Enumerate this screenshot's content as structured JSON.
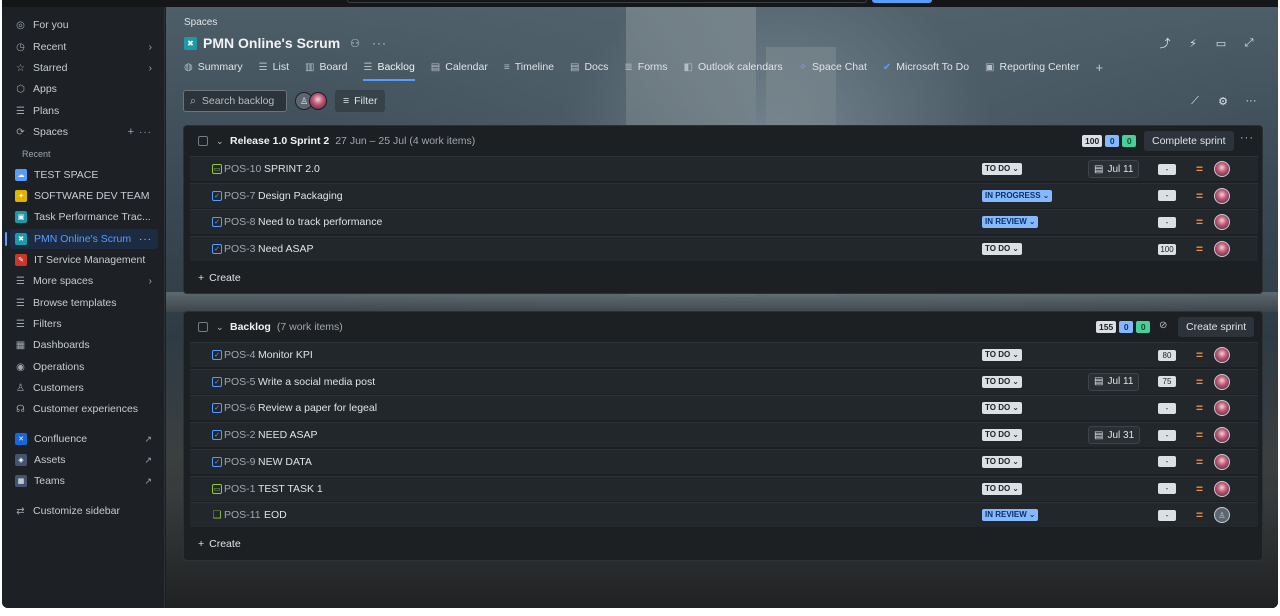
{
  "sidebar": {
    "items": [
      {
        "label": "For you",
        "icon": "person-circle-icon"
      },
      {
        "label": "Recent",
        "icon": "clock-icon"
      },
      {
        "label": "Starred",
        "icon": "star-icon"
      },
      {
        "label": "Apps",
        "icon": "apps-icon"
      },
      {
        "label": "Plans",
        "icon": "plans-icon"
      },
      {
        "label": "Spaces",
        "icon": "spaces-icon"
      }
    ],
    "recent_label": "Recent",
    "spaces": [
      {
        "label": "TEST SPACE",
        "color": "#579dff",
        "glyph": "☁"
      },
      {
        "label": "SOFTWARE DEV TEAM",
        "color": "#e2b203",
        "glyph": "✦"
      },
      {
        "label": "Task Performance Trac...",
        "color": "#1d9aaa",
        "glyph": "▣"
      },
      {
        "label": "PMN Online's Scrum",
        "color": "#1d9aaa",
        "glyph": "✖"
      },
      {
        "label": "IT Service Management",
        "color": "#c9372c",
        "glyph": "✎"
      }
    ],
    "more_spaces": "More spaces",
    "browse_templates": "Browse templates",
    "lower_items": [
      {
        "label": "Filters",
        "icon": "filter-icon"
      },
      {
        "label": "Dashboards",
        "icon": "dashboard-icon"
      },
      {
        "label": "Operations",
        "icon": "operations-icon"
      },
      {
        "label": "Customers",
        "icon": "customers-icon"
      },
      {
        "label": "Customer experiences",
        "icon": "headset-icon"
      }
    ],
    "apps": [
      {
        "label": "Confluence",
        "color": "#1868db",
        "glyph": "✕"
      },
      {
        "label": "Assets",
        "color": "#44546f",
        "glyph": "◈"
      },
      {
        "label": "Teams",
        "color": "#44546f",
        "glyph": "▦"
      }
    ],
    "customize": "Customize sidebar"
  },
  "header": {
    "breadcrumb": "Spaces",
    "title": "PMN Online's Scrum"
  },
  "tabs": [
    {
      "label": "Summary",
      "icon": "globe-icon",
      "glyph": "◍"
    },
    {
      "label": "List",
      "icon": "list-icon",
      "glyph": "☰"
    },
    {
      "label": "Board",
      "icon": "board-icon",
      "glyph": "▥"
    },
    {
      "label": "Backlog",
      "icon": "backlog-icon",
      "glyph": "☰"
    },
    {
      "label": "Calendar",
      "icon": "calendar-icon",
      "glyph": "▤"
    },
    {
      "label": "Timeline",
      "icon": "timeline-icon",
      "glyph": "≡"
    },
    {
      "label": "Docs",
      "icon": "docs-icon",
      "glyph": "▤"
    },
    {
      "label": "Forms",
      "icon": "forms-icon",
      "glyph": "≣"
    },
    {
      "label": "Outlook calendars",
      "icon": "outlook-icon",
      "glyph": "◧"
    },
    {
      "label": "Space Chat",
      "icon": "chat-icon",
      "glyph": "✧"
    },
    {
      "label": "Microsoft To Do",
      "icon": "todo-icon",
      "glyph": "✔"
    },
    {
      "label": "Reporting Center",
      "icon": "reporting-icon",
      "glyph": "▣"
    }
  ],
  "toolbar": {
    "search_placeholder": "Search backlog",
    "filter_label": "Filter"
  },
  "sprint": {
    "title": "Release 1.0 Sprint 2",
    "meta": "27 Jun – 25 Jul (4 work items)",
    "counts": {
      "todo": "100",
      "in_progress": "0",
      "done": "0"
    },
    "action": "Complete sprint",
    "items": [
      {
        "type": "story",
        "key": "POS-10",
        "summary": "SPRINT 2.0",
        "status": "TO DO",
        "status_kind": "todo",
        "date": "Jul 11",
        "estimate": "-",
        "assignee": "photo"
      },
      {
        "type": "task",
        "key": "POS-7",
        "summary": "Design Packaging",
        "status": "IN PROGRESS",
        "status_kind": "prog",
        "date": "",
        "estimate": "-",
        "assignee": "photo"
      },
      {
        "type": "task",
        "key": "POS-8",
        "summary": "Need to track performance",
        "status": "IN REVIEW",
        "status_kind": "review",
        "date": "",
        "estimate": "-",
        "assignee": "photo"
      },
      {
        "type": "task",
        "key": "POS-3",
        "summary": "Need ASAP",
        "status": "TO DO",
        "status_kind": "todo",
        "date": "",
        "estimate": "100",
        "assignee": "photo"
      }
    ],
    "create_label": "Create"
  },
  "backlog": {
    "title": "Backlog",
    "meta": "(7 work items)",
    "counts": {
      "todo": "155",
      "in_progress": "0",
      "done": "0"
    },
    "action": "Create sprint",
    "items": [
      {
        "type": "task",
        "key": "POS-4",
        "summary": "Monitor KPI",
        "status": "TO DO",
        "status_kind": "todo",
        "date": "",
        "estimate": "80",
        "assignee": "photo"
      },
      {
        "type": "task",
        "key": "POS-5",
        "summary": "Write a social media post",
        "status": "TO DO",
        "status_kind": "todo",
        "date": "Jul 11",
        "estimate": "75",
        "assignee": "photo"
      },
      {
        "type": "task",
        "key": "POS-6",
        "summary": "Review a paper for legeal",
        "status": "TO DO",
        "status_kind": "todo",
        "date": "",
        "estimate": "-",
        "assignee": "photo"
      },
      {
        "type": "task",
        "key": "POS-2",
        "summary": "NEED ASAP",
        "status": "TO DO",
        "status_kind": "todo",
        "date": "Jul 31",
        "estimate": "-",
        "assignee": "photo"
      },
      {
        "type": "task",
        "key": "POS-9",
        "summary": "NEW DATA",
        "status": "TO DO",
        "status_kind": "todo",
        "date": "",
        "estimate": "-",
        "assignee": "photo"
      },
      {
        "type": "story",
        "key": "POS-1",
        "summary": "TEST TASK 1",
        "status": "TO DO",
        "status_kind": "todo",
        "date": "",
        "estimate": "-",
        "assignee": "photo"
      },
      {
        "type": "bookmark",
        "key": "POS-11",
        "summary": "EOD",
        "status": "IN REVIEW",
        "status_kind": "review",
        "date": "",
        "estimate": "-",
        "assignee": "none"
      }
    ],
    "create_label": "Create"
  }
}
